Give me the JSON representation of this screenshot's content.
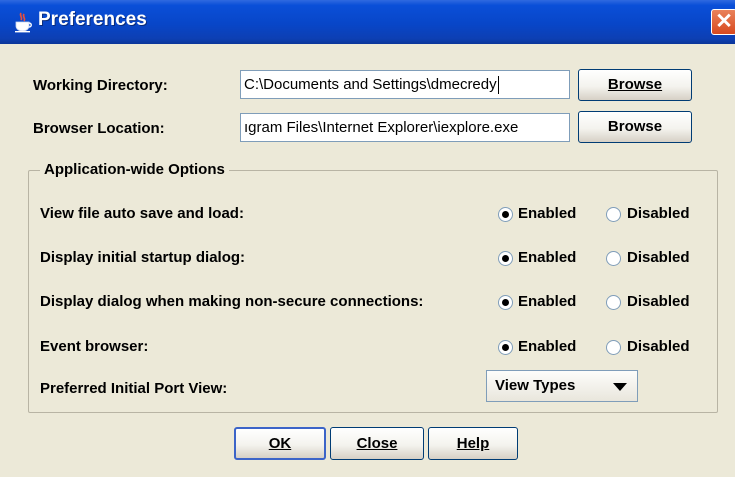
{
  "window": {
    "title": "Preferences",
    "close_glyph": "✕"
  },
  "fields": {
    "working_directory": {
      "label": "Working Directory:",
      "value": "C:\\Documents and Settings\\dmecredy",
      "button": "Browse"
    },
    "browser_location": {
      "label": "Browser Location:",
      "value": "ıgram Files\\Internet Explorer\\iexplore.exe",
      "button": "Browse"
    }
  },
  "options_group": {
    "title": "Application-wide Options",
    "options": [
      {
        "label": "View file auto save and load:",
        "enabled_label": "Enabled",
        "disabled_label": "Disabled",
        "selected": "Enabled"
      },
      {
        "label": "Display initial startup dialog:",
        "enabled_label": "Enabled",
        "disabled_label": "Disabled",
        "selected": "Enabled"
      },
      {
        "label": "Display dialog when making non-secure connections:",
        "enabled_label": "Enabled",
        "disabled_label": "Disabled",
        "selected": "Enabled"
      },
      {
        "label": "Event browser:",
        "enabled_label": "Enabled",
        "disabled_label": "Disabled",
        "selected": "Enabled"
      }
    ],
    "port_view": {
      "label": "Preferred Initial Port View:",
      "selected": "View Types"
    }
  },
  "buttons": {
    "ok": "OK",
    "close": "Close",
    "help": "Help"
  },
  "colors": {
    "titlebar": "#0846c8",
    "dialog_bg": "#ece9d8",
    "close_button": "#d8491f",
    "field_border": "#7f9db9"
  },
  "icons": {
    "title": "java-coffee-cup-icon",
    "close": "close-icon",
    "combo": "chevron-down-icon"
  }
}
